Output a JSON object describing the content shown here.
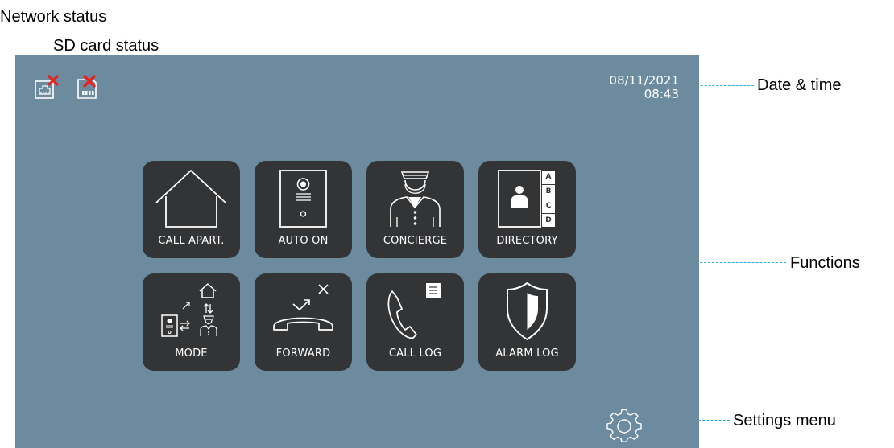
{
  "annotations": {
    "network_status": "Network status",
    "sd_card_status": "SD card status",
    "date_time": "Date & time",
    "functions": "Functions",
    "settings_menu": "Settings menu"
  },
  "screen": {
    "date": "08/11/2021",
    "time": "08:43",
    "status_icons": [
      {
        "name": "network-status-icon",
        "state": "disconnected"
      },
      {
        "name": "sd-card-status-icon",
        "state": "missing"
      }
    ],
    "tiles": [
      {
        "label": "CALL APART.",
        "icon": "house-icon"
      },
      {
        "label": "AUTO ON",
        "icon": "door-panel-icon"
      },
      {
        "label": "CONCIERGE",
        "icon": "concierge-icon"
      },
      {
        "label": "DIRECTORY",
        "icon": "directory-icon"
      },
      {
        "label": "MODE",
        "icon": "mode-icon"
      },
      {
        "label": "FORWARD",
        "icon": "forward-call-icon"
      },
      {
        "label": "CALL LOG",
        "icon": "call-log-icon"
      },
      {
        "label": "ALARM LOG",
        "icon": "shield-icon"
      }
    ],
    "settings_icon": "gear-icon",
    "directory_letters": [
      "A",
      "B",
      "C",
      "D"
    ]
  },
  "colors": {
    "screen_background": "#6c8b9e",
    "tile_background": "#333436",
    "callout_line": "#29a9e0",
    "status_error": "#e52421"
  }
}
